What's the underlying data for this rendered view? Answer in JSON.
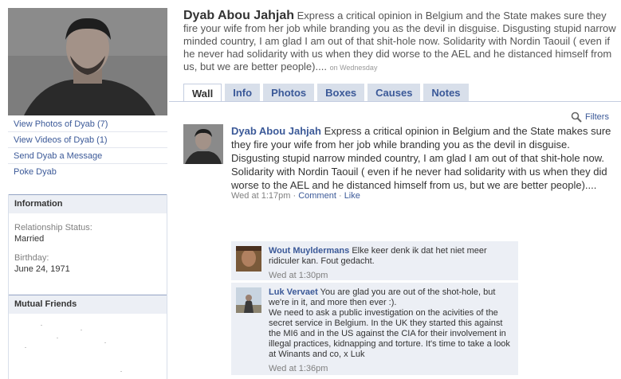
{
  "profile": {
    "name": "Dyab Abou Jahjah",
    "status": "Express a critical opinion in Belgium and the State makes sure they fire your wife from her job while branding you as the devil in disguise. Disgusting stupid narrow minded country, I am glad I am out of that shit-hole now. Solidarity with Nordin Taouil ( even if he never had solidarity with us when they did worse to the AEL and he distanced himself from us, but we are better people)....",
    "status_time": "on Wednesday"
  },
  "sidebar": {
    "links": [
      "View Photos of Dyab (7)",
      "View Videos of Dyab (1)",
      "Send Dyab a Message",
      "Poke Dyab"
    ]
  },
  "information": {
    "title": "Information",
    "relationship_label": "Relationship Status:",
    "relationship_value": "Married",
    "birthday_label": "Birthday:",
    "birthday_value": "June 24, 1971"
  },
  "mutual_friends": {
    "title": "Mutual Friends"
  },
  "tabs": [
    "Wall",
    "Info",
    "Photos",
    "Boxes",
    "Causes",
    "Notes"
  ],
  "active_tab": "Wall",
  "filters_label": "Filters",
  "post": {
    "author": "Dyab Abou Jahjah",
    "text": "Express a critical opinion in Belgium and the State makes sure they fire your wife from her job while branding you as the devil in disguise. Disgusting stupid narrow minded country, I am glad I am out of that shit-hole now. Solidarity with Nordin Taouil ( even if he never had solidarity with us when they did worse to the AEL and he distanced himself from us, but we are better people)....",
    "time": "Wed at 1:17pm",
    "sep": "·",
    "comment_label": "Comment",
    "like_label": "Like"
  },
  "comments": [
    {
      "author": "Wout Muyldermans",
      "text": "Elke keer denk ik dat het niet meer ridiculer kan. Fout gedacht.",
      "time": "Wed at 1:30pm"
    },
    {
      "author": "Luk Vervaet",
      "text": "You are glad you are out of the shot-hole, but we're in it, and more then ever :).",
      "text2": "We need to ask a public investigation on the acivities of the secret service in Belgium. In the UK they started this against the MI6 and in the US against the CIA for their involvement in illegal practices, kidnapping and torture. It's time to take a look at Winants and co, x Luk",
      "time": "Wed at 1:36pm"
    }
  ],
  "colors": {
    "link": "#3b5998",
    "header_band": "#eceff5",
    "tab_bg": "#d8dfea",
    "comment_bg": "#eceff5"
  }
}
